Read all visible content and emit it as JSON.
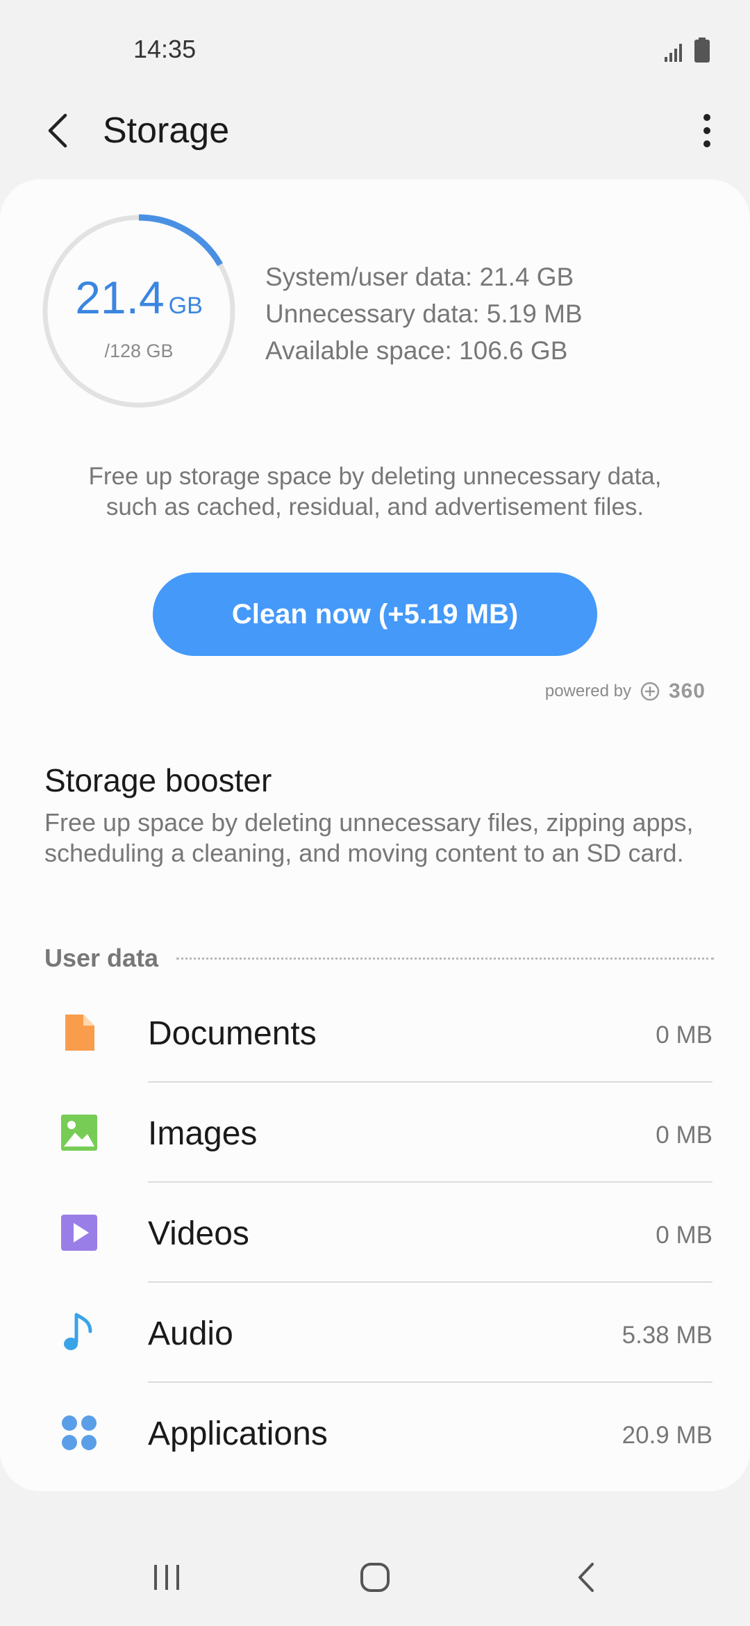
{
  "status_bar": {
    "time": "14:35"
  },
  "header": {
    "title": "Storage"
  },
  "storage": {
    "used": "21.4",
    "used_unit": "GB",
    "total": "/128 GB",
    "used_fraction": 0.167,
    "ring_color": "#4a90e2",
    "stats": [
      "System/user data: 21.4 GB",
      "Unnecessary data: 5.19 MB",
      "Available space: 106.6 GB"
    ],
    "description_line1": "Free up storage space by deleting unnecessary data,",
    "description_line2": "such as cached, residual, and advertisement files.",
    "clean_label": "Clean now (+5.19 MB)",
    "powered_by": "powered by",
    "brand": "360"
  },
  "booster": {
    "title": "Storage booster",
    "description": "Free up space by deleting unnecessary files, zipping apps, scheduling a cleaning, and moving content to an SD card."
  },
  "user_data": {
    "label": "User data",
    "items": [
      {
        "label": "Documents",
        "value": "0 MB",
        "icon": "document-icon",
        "color": "#f99d4c"
      },
      {
        "label": "Images",
        "value": "0 MB",
        "icon": "image-icon",
        "color": "#77cc55"
      },
      {
        "label": "Videos",
        "value": "0 MB",
        "icon": "video-icon",
        "color": "#9a7ee8"
      },
      {
        "label": "Audio",
        "value": "5.38 MB",
        "icon": "music-note-icon",
        "color": "#3aa3e8"
      },
      {
        "label": "Applications",
        "value": "20.9 MB",
        "icon": "apps-icon",
        "color": "#5b9ee8"
      }
    ]
  },
  "accent": "#4499f9"
}
